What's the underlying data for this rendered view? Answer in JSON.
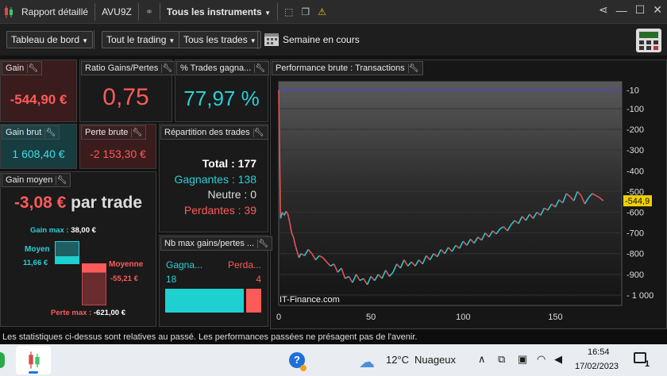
{
  "titlebar": {
    "title": "Rapport détaillé",
    "account": "AVU9Z",
    "instruments": "Tous les instruments"
  },
  "toolbar": {
    "dashboard": "Tableau de bord",
    "trading": "Tout le trading",
    "trades": "Tous les trades",
    "period": "Semaine en cours"
  },
  "panels": {
    "gain": {
      "title": "Gain",
      "value": "-544,90 €"
    },
    "ratio": {
      "title": "Ratio Gains/Pertes",
      "value": "0,75"
    },
    "pct": {
      "title": "% Trades gagna...",
      "value": "77,97 %"
    },
    "gain_brut": {
      "title": "Gain brut",
      "value": "1 608,40 €"
    },
    "perte_brute": {
      "title": "Perte brute",
      "value": "-2 153,30 €"
    },
    "repartition": {
      "title": "Répartition des trades",
      "total_label": "Total :",
      "total_value": "177",
      "winners_label": "Gagnantes :",
      "winners_value": "138",
      "neutral_label": "Neutre :",
      "neutral_value": "0",
      "losers_label": "Perdantes :",
      "losers_value": "39"
    },
    "gain_moyen": {
      "title": "Gain moyen",
      "value": "-3,08 €",
      "suffix": "par trade",
      "gain_max_label": "Gain max :",
      "gain_max_value": "38,00 €",
      "moyen_label": "Moyen",
      "moyen_value": "11,66 €",
      "moyenne_label": "Moyenne",
      "moyenne_value": "-55,21 €",
      "perte_max_label": "Perte max :",
      "perte_max_value": "-621,00 €"
    },
    "nb_max": {
      "title": "Nb max gains/pertes ...",
      "win_label": "Gagna...",
      "loss_label": "Perda...",
      "win_value": "18",
      "loss_value": "4",
      "win_fraction": 0.818
    }
  },
  "chart": {
    "title": "Performance brute : Transactions",
    "watermark": "IT-Finance.com"
  },
  "chart_data": {
    "type": "line",
    "x_ticks": [
      "0",
      "50",
      "100",
      "150"
    ],
    "y_ticks": [
      "-10",
      "-100",
      "-200",
      "-300",
      "-400",
      "-500",
      "-600",
      "-700",
      "-800",
      "-900",
      "- 1 000"
    ],
    "y_tick_values": [
      -10,
      -100,
      -200,
      -300,
      -400,
      -500,
      -600,
      -700,
      -800,
      -900,
      -1000
    ],
    "xlim": [
      0,
      186
    ],
    "ylim": [
      -1050,
      30
    ],
    "current_value_label": "-544,9",
    "baseline": -10,
    "colors": {
      "up": "#28c8d0",
      "down": "#e05555",
      "baseline": "#4040ff"
    },
    "series": [
      {
        "x": [
          0,
          1,
          2,
          3,
          4,
          5,
          6,
          7,
          8,
          9,
          10,
          11,
          12,
          14,
          16,
          18,
          20,
          22,
          24,
          26,
          28,
          30,
          32,
          34,
          36,
          38,
          40,
          42,
          44,
          46,
          48,
          50,
          52,
          54,
          56,
          58,
          60,
          62,
          64,
          66,
          68,
          70,
          72,
          74,
          76,
          78,
          80,
          82,
          84,
          86,
          88,
          90,
          92,
          94,
          96,
          98,
          100,
          102,
          104,
          106,
          108,
          110,
          112,
          114,
          116,
          118,
          120,
          122,
          124,
          126,
          128,
          130,
          132,
          134,
          136,
          138,
          140,
          142,
          144,
          146,
          148,
          150,
          152,
          154,
          156,
          158,
          160,
          162,
          164,
          166,
          168,
          170,
          172,
          174,
          176
        ],
        "y": [
          -10,
          -630,
          -600,
          -615,
          -595,
          -610,
          -650,
          -700,
          -720,
          -760,
          -790,
          -820,
          -800,
          -810,
          -780,
          -800,
          -830,
          -810,
          -820,
          -840,
          -860,
          -850,
          -890,
          -870,
          -920,
          -910,
          -940,
          -900,
          -930,
          -920,
          -950,
          -910,
          -930,
          -900,
          -920,
          -880,
          -910,
          -890,
          -850,
          -870,
          -830,
          -860,
          -840,
          -860,
          -830,
          -850,
          -810,
          -830,
          -800,
          -815,
          -780,
          -800,
          -770,
          -790,
          -760,
          -775,
          -740,
          -760,
          -730,
          -750,
          -720,
          -735,
          -700,
          -720,
          -690,
          -705,
          -680,
          -670,
          -690,
          -660,
          -640,
          -655,
          -620,
          -640,
          -610,
          -630,
          -600,
          -615,
          -580,
          -590,
          -560,
          -575,
          -540,
          -555,
          -510,
          -525,
          -545,
          -500,
          -520,
          -560,
          -530,
          -510,
          -520,
          -530,
          -545
        ]
      }
    ]
  },
  "footer": {
    "disclaimer": "Les statistiques ci-dessus sont relatives au passé. Les performances passées ne présagent pas de l'avenir."
  },
  "taskbar": {
    "weather_temp": "12°C",
    "weather_desc": "Nuageux",
    "time": "16:54",
    "date": "17/02/2023",
    "notif_count": "1"
  }
}
